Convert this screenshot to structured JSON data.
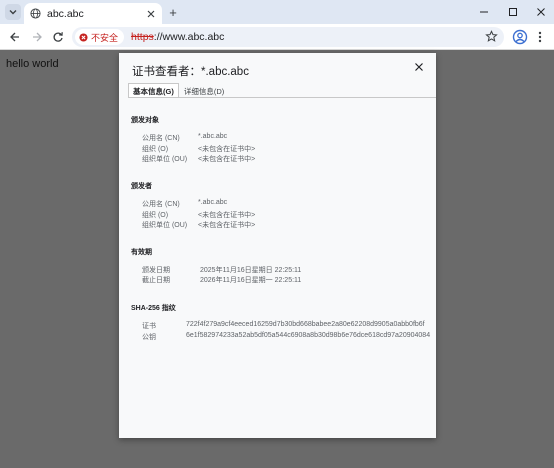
{
  "browser": {
    "tab_title": "abc.abc",
    "new_tab_symbol": "+",
    "security_chip": "不安全",
    "url_scheme": "https",
    "url_rest": "://www.abc.abc"
  },
  "page": {
    "body_text": "hello world"
  },
  "dialog": {
    "title": "证书查看者：*.abc.abc",
    "tabs": [
      "基本信息(G)",
      "详细信息(D)"
    ],
    "issued_to": {
      "heading": "颁发对象",
      "rows": [
        {
          "label": "公用名 (CN)",
          "value": "*.abc.abc"
        },
        {
          "label": "组织 (O)",
          "value": "<未包含在证书中>"
        },
        {
          "label": "组织单位 (OU)",
          "value": "<未包含在证书中>"
        }
      ]
    },
    "issued_by": {
      "heading": "颁发者",
      "rows": [
        {
          "label": "公用名 (CN)",
          "value": "*.abc.abc"
        },
        {
          "label": "组织 (O)",
          "value": "<未包含在证书中>"
        },
        {
          "label": "组织单位 (OU)",
          "value": "<未包含在证书中>"
        }
      ]
    },
    "validity": {
      "heading": "有效期",
      "rows": [
        {
          "label": "颁发日期",
          "value": "2025年11月16日星期日 22:25:11"
        },
        {
          "label": "截止日期",
          "value": "2026年11月16日星期一 22:25:11"
        }
      ]
    },
    "fingerprints": {
      "heading": "SHA-256 指纹",
      "rows": [
        {
          "label": "证书",
          "value": "722f4f279a9cf4eeced16259d7b30bd668babee2a80e62208d9905a0abb0fb6f"
        },
        {
          "label": "公钥",
          "value": "6e1f582974233a52ab5df05a544c6908a8b30d98b6e76dce618cd97a20904084"
        }
      ]
    }
  }
}
